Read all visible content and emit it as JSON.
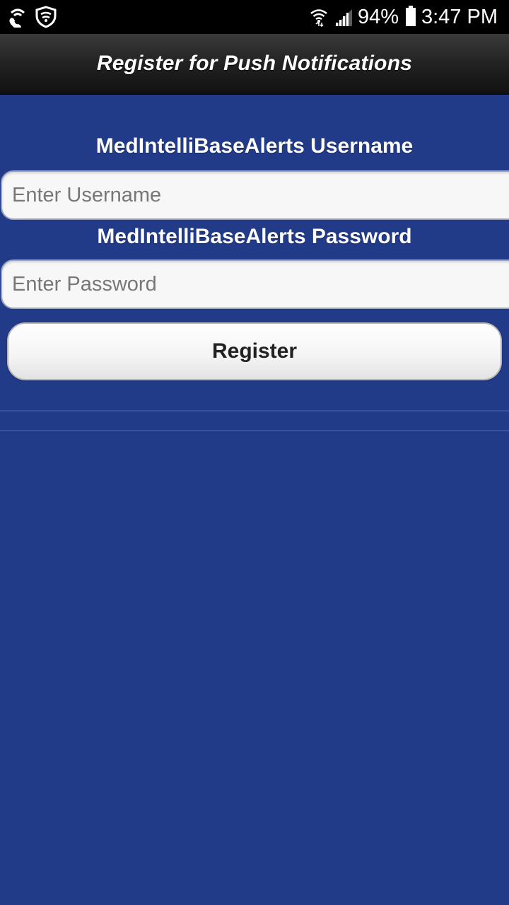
{
  "status_bar": {
    "battery_percent": "94%",
    "time": "3:47 PM",
    "icons": [
      "wifi-calling-icon",
      "shield-icon",
      "wifi-icon",
      "signal-icon",
      "battery-icon"
    ]
  },
  "header": {
    "title": "Register for Push Notifications"
  },
  "form": {
    "username_label": "MedIntelliBaseAlerts Username",
    "username_placeholder": "Enter Username",
    "password_label": "MedIntelliBaseAlerts Password",
    "password_placeholder": "Enter Password",
    "register_label": "Register"
  },
  "colors": {
    "background": "#223b89",
    "header": "#1a1a1a",
    "status_bar": "#000000"
  }
}
